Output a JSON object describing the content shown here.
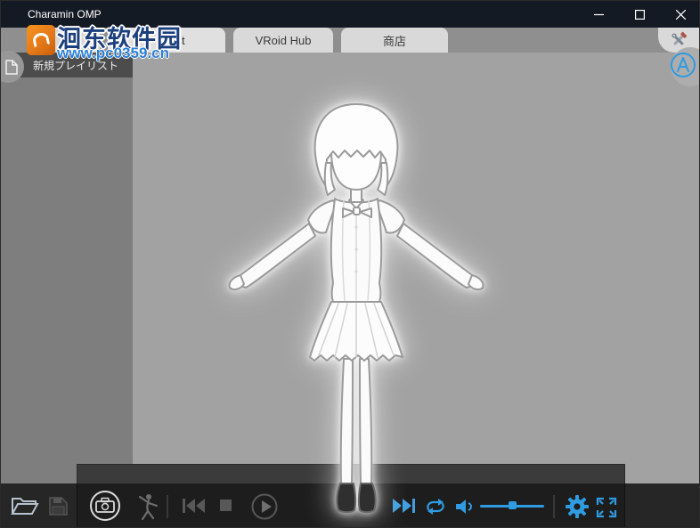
{
  "window": {
    "title": "Charamin OMP"
  },
  "watermark": {
    "site_name": "洄东软件园",
    "site_url": "www.pc0359.cn"
  },
  "tabs": [
    {
      "label": ""
    },
    {
      "label": "Playlist",
      "active": true
    },
    {
      "label": "VRoid Hub"
    },
    {
      "label": "商店"
    }
  ],
  "sidebar": {
    "playlist_header": "新規プレイリスト"
  },
  "viewport": {
    "character": "anime girl 3D model in T-pose"
  },
  "toolbar": {
    "accent_color": "#2f9be0",
    "volume_percent": 45,
    "icons": [
      "open-folder",
      "save",
      "screenshot-camera",
      "motion-figure",
      "skip-previous",
      "stop",
      "play",
      "skip-next",
      "repeat-loop",
      "volume-speaker",
      "volume-slider",
      "settings-gear",
      "fullscreen-expand",
      "tools-wrench",
      "effect-a",
      "document-page"
    ]
  }
}
